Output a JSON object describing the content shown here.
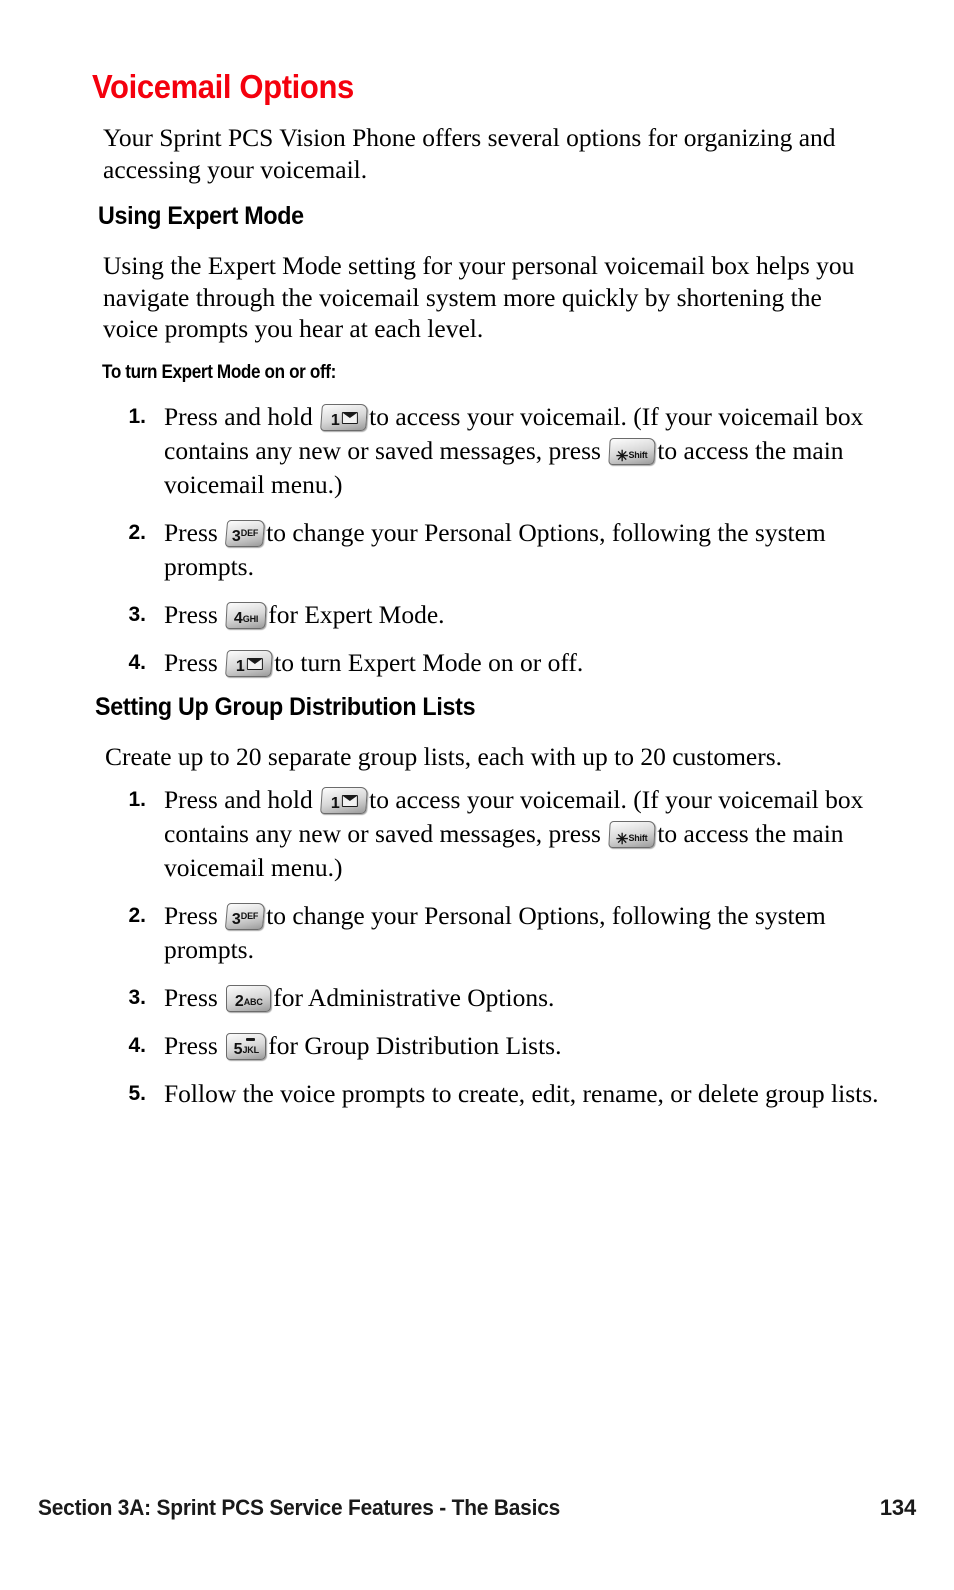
{
  "document": {
    "title": "Voicemail Options",
    "title_color": "#f4000d",
    "intro": "Your Sprint PCS Vision Phone offers several options for organizing and accessing your voicemail."
  },
  "sections": [
    {
      "heading": "Using Expert Mode",
      "paragraph": "Using the Expert Mode setting for your personal voicemail box helps you navigate through the voicemail system more quickly by shortening the voice prompts you hear at each level.",
      "subheading": "To turn Expert Mode on or off:",
      "steps": [
        {
          "number": "1.",
          "text_before": "Press and hold",
          "key1": "1-envelope",
          "text_middle": "to access your voicemail. (If your voicemail box contains any new or saved messages, press",
          "key2": "star-shift",
          "text_after": "to access the main voicemail menu.)"
        },
        {
          "number": "2.",
          "text_before": "Press",
          "key1": "3-def",
          "text_after": "to change your Personal Options, following the system prompts."
        },
        {
          "number": "3.",
          "text_before": "Press",
          "key1": "4-ghi",
          "text_after": "for Expert Mode."
        },
        {
          "number": "4.",
          "text_before": "Press",
          "key1": "1-envelope",
          "text_after": "to turn Expert Mode on or off."
        }
      ]
    },
    {
      "heading": "Setting Up Group Distribution Lists",
      "paragraph": "Create up to 20 separate group lists, each with up to 20 customers.",
      "steps": [
        {
          "number": "1.",
          "text_before": "Press and hold",
          "key1": "1-envelope",
          "text_middle": "to access your voicemail. (If your voicemail box contains any new or saved messages, press",
          "key2": "star-shift",
          "text_after": "to access the main voicemail menu.)"
        },
        {
          "number": "2.",
          "text_before": "Press",
          "key1": "3-def",
          "text_after": "to change your Personal Options, following the system prompts."
        },
        {
          "number": "3.",
          "text_before": "Press",
          "key1": "2-abc",
          "text_after": "for Administrative Options."
        },
        {
          "number": "4.",
          "text_before": "Press",
          "key1": "5-jkl",
          "text_after": "for Group Distribution Lists."
        },
        {
          "number": "5.",
          "text_before": "Follow the voice prompts to create, edit, rename, or delete group lists.",
          "key1": "",
          "text_after": ""
        }
      ]
    }
  ],
  "keys": {
    "one": {
      "digit": "1",
      "letters": ""
    },
    "two": {
      "digit": "2",
      "letters": "ABC"
    },
    "three": {
      "digit": "3",
      "letters": "DEF"
    },
    "four": {
      "digit": "4",
      "letters": "GHI"
    },
    "five": {
      "digit": "5",
      "letters": "JKL"
    },
    "star": {
      "digit": "✳",
      "letters": "Shift"
    }
  },
  "footer": {
    "section_label": "Section 3A: Sprint PCS Service Features - The Basics",
    "page_number": "134"
  }
}
